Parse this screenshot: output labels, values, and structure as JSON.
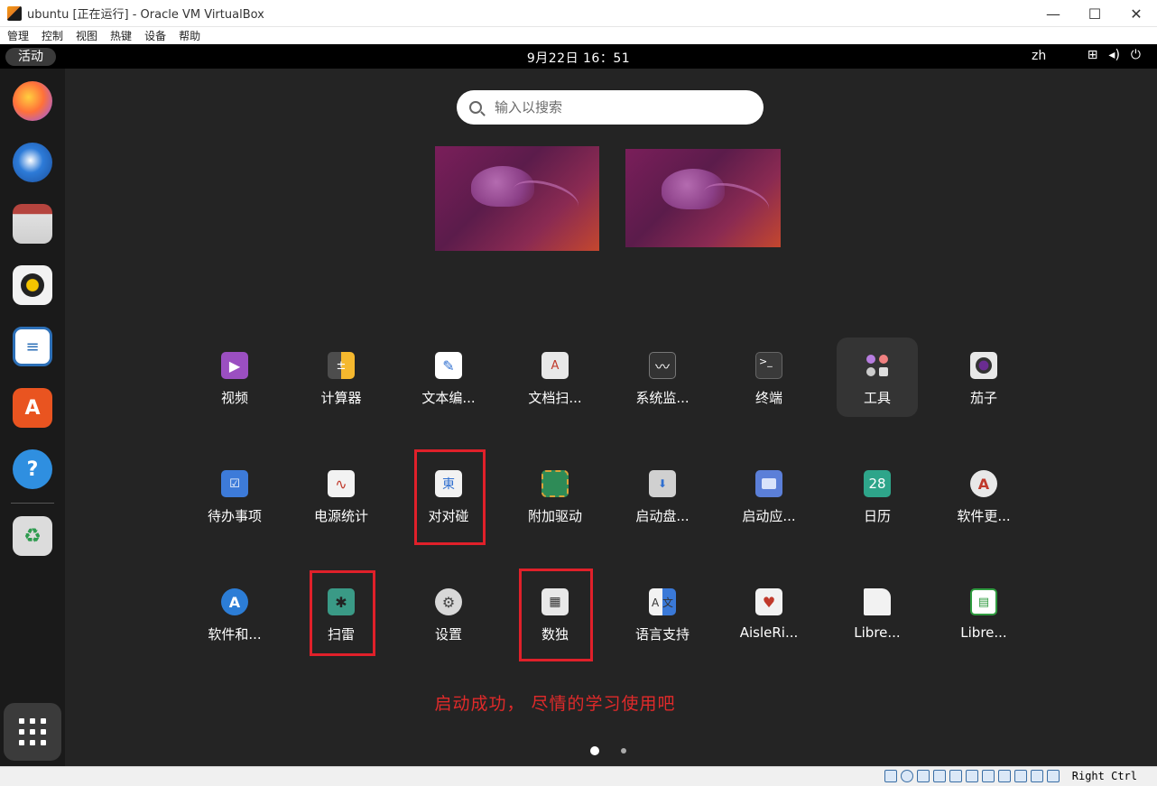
{
  "window": {
    "title": "ubuntu [正在运行] - Oracle VM VirtualBox",
    "minimize": "—",
    "maximize": "☐",
    "close": "✕"
  },
  "menu": [
    "管理",
    "控制",
    "视图",
    "热键",
    "设备",
    "帮助"
  ],
  "topbar": {
    "activities": "活动",
    "clock": "9月22日  16：51",
    "lang": "zh",
    "icons": [
      "network-icon",
      "volume-icon",
      "power-icon"
    ]
  },
  "dock": {
    "items": [
      "firefox-icon",
      "thunderbird-icon",
      "files-icon",
      "rhythmbox-icon",
      "libreoffice-writer-icon",
      "ubuntu-software-icon",
      "help-icon",
      "trash-icon"
    ],
    "show_apps": "show-apps-icon"
  },
  "search": {
    "placeholder": "输入以搜索"
  },
  "apps": [
    {
      "label": "视频",
      "icon": "video-icon",
      "color": "#9b4fc1"
    },
    {
      "label": "计算器",
      "icon": "calculator-icon",
      "color": "#4d4d4d"
    },
    {
      "label": "文本编...",
      "icon": "text-editor-icon",
      "color": "#ffffff"
    },
    {
      "label": "文档扫...",
      "icon": "document-scanner-icon",
      "color": "#e8e8e8"
    },
    {
      "label": "系统监...",
      "icon": "system-monitor-icon",
      "color": "#333333"
    },
    {
      "label": "终端",
      "icon": "terminal-icon",
      "color": "#3a3a3a"
    },
    {
      "label": "工具",
      "icon": "utilities-folder-icon",
      "color": "#343434"
    },
    {
      "label": "茄子",
      "icon": "cheese-icon",
      "color": "#e8e8e8"
    },
    {
      "label": "待办事项",
      "icon": "todo-icon",
      "color": "#3d7bd9"
    },
    {
      "label": "电源统计",
      "icon": "power-statistics-icon",
      "color": "#f2f2f2"
    },
    {
      "label": "对对碰",
      "icon": "mahjongg-icon",
      "color": "#f2f2f2"
    },
    {
      "label": "附加驱动",
      "icon": "additional-drivers-icon",
      "color": "#2e8b57"
    },
    {
      "label": "启动盘...",
      "icon": "startup-disk-icon",
      "color": "#d0d0d0"
    },
    {
      "label": "启动应...",
      "icon": "startup-apps-icon",
      "color": "#5b7fd8"
    },
    {
      "label": "日历",
      "icon": "calendar-icon",
      "color": "#2ea58a"
    },
    {
      "label": "软件更...",
      "icon": "software-updater-icon",
      "color": "#e8e8e8"
    },
    {
      "label": "软件和...",
      "icon": "software-properties-icon",
      "color": "#2c7dd6"
    },
    {
      "label": "扫雷",
      "icon": "mines-icon",
      "color": "#3a9a86"
    },
    {
      "label": "设置",
      "icon": "settings-icon",
      "color": "#d8d8d8"
    },
    {
      "label": "数独",
      "icon": "sudoku-icon",
      "color": "#e8e8e8"
    },
    {
      "label": "语言支持",
      "icon": "language-support-icon",
      "color": "#3a79d8"
    },
    {
      "label": "AisleRi...",
      "icon": "aisleriot-icon",
      "color": "#f2f2f2"
    },
    {
      "label": "Libre...",
      "icon": "libreoffice-draw-icon",
      "color": "#f2f2f2"
    },
    {
      "label": "Libre...",
      "icon": "libreoffice-calc-icon",
      "color": "#2f9b3f"
    }
  ],
  "annotation": "启动成功，  尽情的学习使用吧",
  "status": {
    "host_key": "Right Ctrl"
  }
}
